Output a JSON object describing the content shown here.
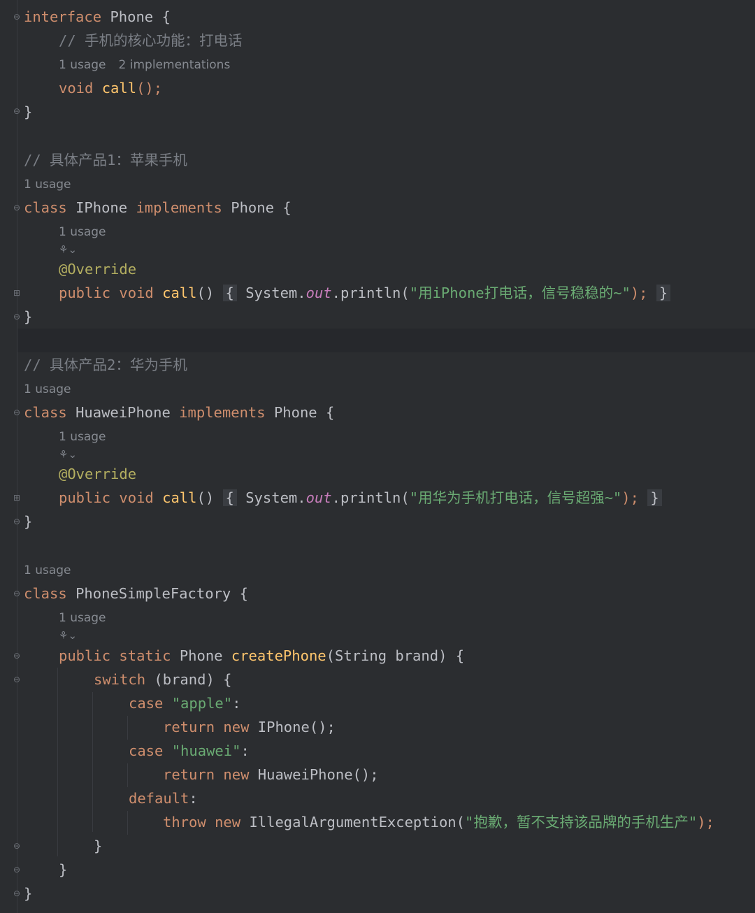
{
  "editor": {
    "hints": {
      "phone_usage": "1 usage",
      "phone_impls": "2 implementations",
      "iphone_class_usage": "1 usage",
      "iphone_call_usage": "1 usage",
      "huawei_class_usage": "1 usage",
      "huawei_call_usage": "1 usage",
      "factory_class_usage": "1 usage",
      "factory_method_usage": "1 usage"
    },
    "lines": {
      "l1": [
        "interface",
        "Phone",
        "{"
      ],
      "l2": "// 手机的核心功能：打电话",
      "l3": [
        "void",
        "call",
        "();"
      ],
      "l4": "}",
      "l5": "// 具体产品1：苹果手机",
      "l6": [
        "class",
        "IPhone",
        "implements",
        "Phone",
        "{"
      ],
      "l7": "@Override",
      "l8": [
        "public",
        "void",
        "call",
        "()",
        "{",
        "System.",
        "out",
        ".println(",
        "\"用iPhone打电话，信号稳稳的~\"",
        ");",
        "}"
      ],
      "l9": "}",
      "l10": "// 具体产品2：华为手机",
      "l11": [
        "class",
        "HuaweiPhone",
        "implements",
        "Phone",
        "{"
      ],
      "l12": "@Override",
      "l13": [
        "public",
        "void",
        "call",
        "()",
        "{",
        "System.",
        "out",
        ".println(",
        "\"用华为手机打电话，信号超强~\"",
        ");",
        "}"
      ],
      "l14": "}",
      "l15": [
        "class",
        "PhoneSimpleFactory",
        "{"
      ],
      "l16": [
        "public",
        "static",
        "Phone",
        "createPhone",
        "(String brand) {"
      ],
      "l17": [
        "switch",
        "(brand) {"
      ],
      "l18": [
        "case",
        "\"apple\"",
        ":"
      ],
      "l19": [
        "return",
        "new",
        "IPhone();"
      ],
      "l20": [
        "case",
        "\"huawei\"",
        ":"
      ],
      "l21": [
        "return",
        "new",
        "HuaweiPhone();"
      ],
      "l22": [
        "default",
        ":"
      ],
      "l23": [
        "throw",
        "new",
        "IllegalArgumentException(",
        "\"抱歉，暂不支持该品牌的手机生产\"",
        ");"
      ],
      "l24": "}",
      "l25": "}",
      "l26": "}"
    },
    "ai_icon": "⚘⌄"
  }
}
